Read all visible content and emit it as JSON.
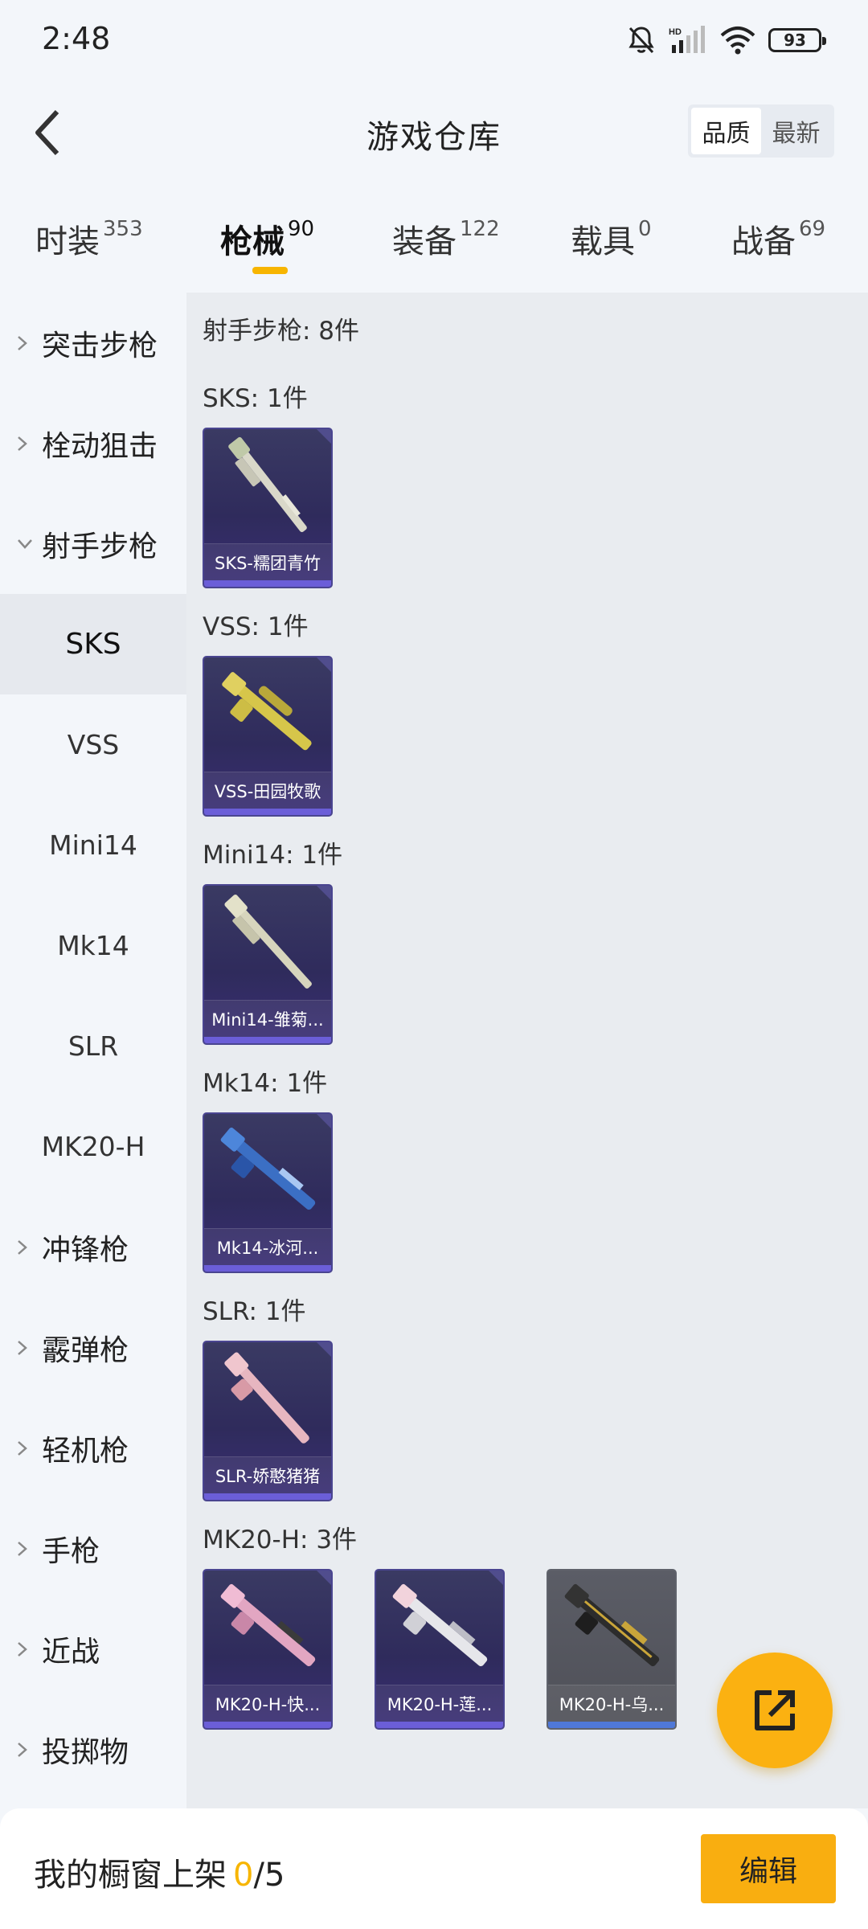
{
  "status_bar": {
    "time": "2:48",
    "battery": "93",
    "hd_label": "HD"
  },
  "header": {
    "title": "游戏仓库",
    "sort_options": [
      "品质",
      "最新"
    ],
    "sort_active": "品质"
  },
  "tabs": [
    {
      "label": "时装",
      "count": "353"
    },
    {
      "label": "枪械",
      "count": "90",
      "active": true
    },
    {
      "label": "装备",
      "count": "122"
    },
    {
      "label": "载具",
      "count": "0"
    },
    {
      "label": "战备",
      "count": "69"
    }
  ],
  "sidebar": {
    "categories": {
      "assault": "突击步枪",
      "bolt": "栓动狙击",
      "marksman": "射手步枪",
      "smg": "冲锋枪",
      "shotgun": "霰弹枪",
      "lmg": "轻机枪",
      "pistol": "手枪",
      "melee": "近战",
      "throw": "投掷物"
    },
    "subitems": [
      "SKS",
      "VSS",
      "Mini14",
      "Mk14",
      "SLR",
      "MK20-H"
    ],
    "active_subitem": "SKS"
  },
  "content": {
    "total": "射手步枪: 8件",
    "groups": [
      {
        "title": "SKS: 1件",
        "items": [
          "SKS-糯团青竹"
        ]
      },
      {
        "title": "VSS: 1件",
        "items": [
          "VSS-田园牧歌"
        ]
      },
      {
        "title": "Mini14: 1件",
        "items": [
          "Mini14-雏菊..."
        ]
      },
      {
        "title": "Mk14: 1件",
        "items": [
          "Mk14-冰河..."
        ]
      },
      {
        "title": "SLR: 1件",
        "items": [
          "SLR-娇憨猪猪"
        ]
      },
      {
        "title": "MK20-H: 3件",
        "items": [
          "MK20-H-快...",
          "MK20-H-莲...",
          "MK20-H-乌..."
        ]
      }
    ]
  },
  "bottom_bar": {
    "label": "我的橱窗上架",
    "count": "0",
    "max": "5",
    "edit_label": "编辑"
  },
  "colors": {
    "accent": "#f7b500",
    "card_purple": "#2f2b5c",
    "fab": "#fbb111"
  }
}
